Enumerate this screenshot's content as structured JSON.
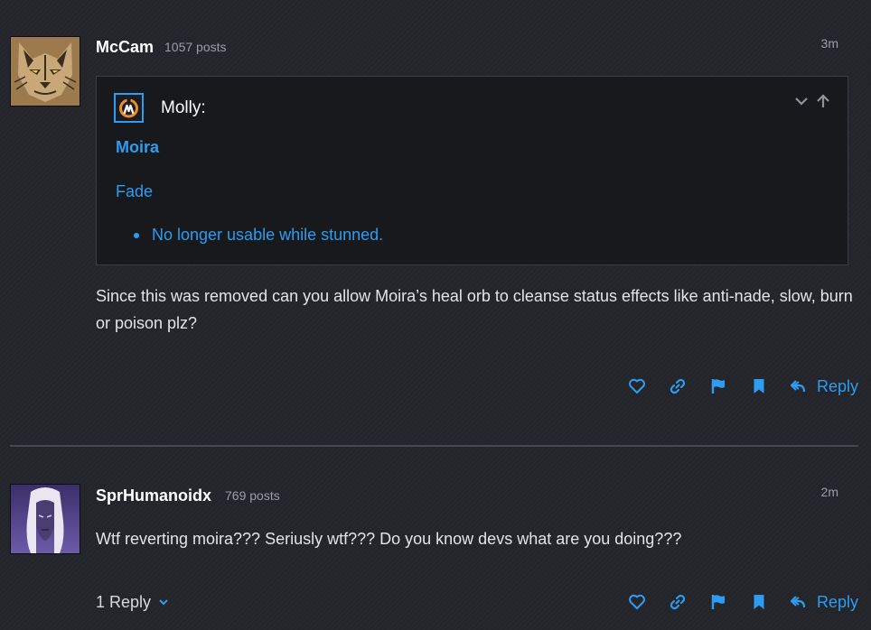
{
  "posts": [
    {
      "author": "McCam",
      "post_count": "1057 posts",
      "time": "3m",
      "quote": {
        "author": "Molly:",
        "heading": "Moira",
        "subheading": "Fade",
        "bullets": [
          "No longer usable while stunned."
        ]
      },
      "body": "Since this was removed can you allow Moira’s heal orb to cleanse status effects like anti-nade, slow, burn or poison plz?",
      "reply_label": "Reply"
    },
    {
      "author": "SprHumanoidx",
      "post_count": "769 posts",
      "time": "2m",
      "body": "Wtf reverting moira??? Seriusly wtf??? Do you know devs what are you doing???",
      "replies_toggle": "1 Reply",
      "reply_label": "Reply"
    }
  ],
  "colors": {
    "accent": "#2e9cf0",
    "background": "#23252b",
    "quote_background": "#17191d",
    "text": "#e2e4e8",
    "muted": "#9a9ea6"
  },
  "icons": {
    "actions": [
      "heart-icon",
      "link-icon",
      "flag-icon",
      "bookmark-icon",
      "reply-arrow-icon"
    ],
    "quote_controls": [
      "chevron-down-icon",
      "arrow-up-icon"
    ],
    "replies_toggle": "chevron-down-icon"
  }
}
